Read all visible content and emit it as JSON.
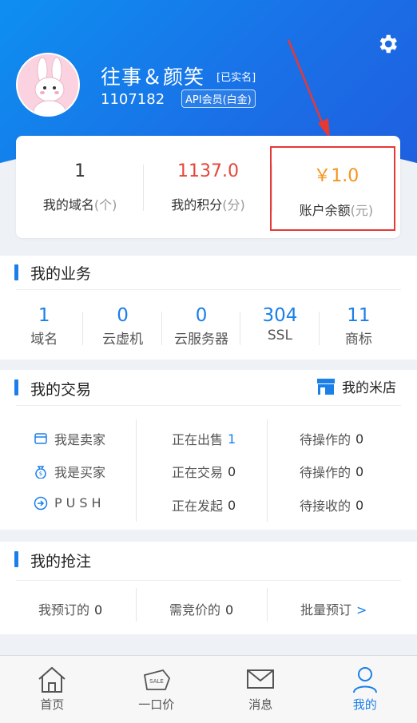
{
  "profile": {
    "username": "往事＆颜笑",
    "realname_badge": "[已实名]",
    "user_id": "1107182",
    "vip_badge": "API会员(白金)"
  },
  "stats": [
    {
      "value": "1",
      "label": "我的域名",
      "unit": "(个)",
      "color": "#333333"
    },
    {
      "value": "1137.0",
      "label": "我的积分",
      "unit": "(分)",
      "color": "#e5463b"
    },
    {
      "value": "￥1.0",
      "label": "账户余额",
      "unit": "(元)",
      "color": "#f7931e"
    }
  ],
  "business": {
    "title": "我的业务",
    "items": [
      {
        "num": "1",
        "label": "域名"
      },
      {
        "num": "0",
        "label": "云虚机"
      },
      {
        "num": "0",
        "label": "云服务器"
      },
      {
        "num": "304",
        "label": "SSL"
      },
      {
        "num": "11",
        "label": "商标"
      }
    ]
  },
  "trade": {
    "title": "我的交易",
    "store_label": "我的米店",
    "rows": [
      {
        "role": "我是卖家",
        "mid_label": "正在出售",
        "mid_num": "1",
        "right_label": "待操作的",
        "right_num": "0"
      },
      {
        "role": "我是买家",
        "mid_label": "正在交易",
        "mid_num": "0",
        "right_label": "待操作的",
        "right_num": "0"
      },
      {
        "role": "PUSH",
        "mid_label": "正在发起",
        "mid_num": "0",
        "right_label": "待接收的",
        "right_num": "0"
      }
    ]
  },
  "grab": {
    "title": "我的抢注",
    "items": [
      {
        "label": "我预订的",
        "num": "0"
      },
      {
        "label": "需竞价的",
        "num": "0"
      },
      {
        "label": "批量预订",
        "suffix": ">"
      }
    ]
  },
  "tabs": [
    {
      "label": "首页",
      "icon": "home-icon"
    },
    {
      "label": "一口价",
      "icon": "sale-tag-icon",
      "tag_text": "SALE"
    },
    {
      "label": "消息",
      "icon": "mail-icon"
    },
    {
      "label": "我的",
      "icon": "user-icon",
      "active": true
    }
  ],
  "colors": {
    "accent": "#1b7fe8",
    "header_start": "#0e8ff0",
    "highlight": "#e53935"
  }
}
